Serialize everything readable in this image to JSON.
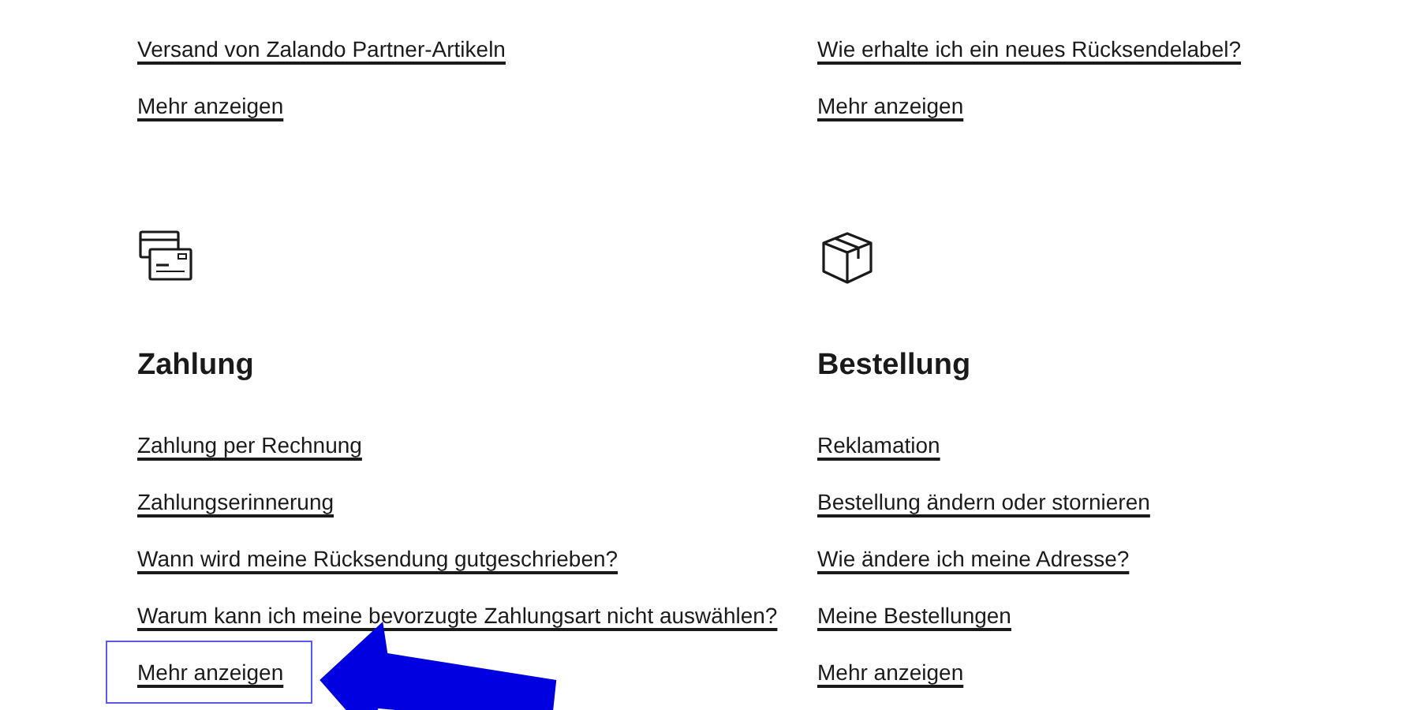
{
  "top_columns": [
    {
      "links": [
        {
          "label": "Versand von Zalando Partner-Artikeln",
          "highlighted": false
        },
        {
          "label": "Mehr anzeigen",
          "highlighted": false
        }
      ]
    },
    {
      "links": [
        {
          "label": "Wie erhalte ich ein neues Rücksendelabel?",
          "highlighted": false
        },
        {
          "label": "Mehr anzeigen",
          "highlighted": false
        }
      ]
    }
  ],
  "sections": [
    {
      "kind": "payment",
      "title": "Zahlung",
      "links": [
        {
          "label": "Zahlung per Rechnung",
          "highlighted": false
        },
        {
          "label": "Zahlungserinnerung",
          "highlighted": false
        },
        {
          "label": "Wann wird meine Rücksendung gutgeschrieben?",
          "highlighted": false
        },
        {
          "label": "Warum kann ich meine bevorzugte Zahlungsart nicht auswählen?",
          "highlighted": false
        },
        {
          "label": "Mehr anzeigen",
          "highlighted": true
        }
      ]
    },
    {
      "kind": "order",
      "title": "Bestellung",
      "links": [
        {
          "label": "Reklamation",
          "highlighted": false
        },
        {
          "label": "Bestellung ändern oder stornieren",
          "highlighted": false
        },
        {
          "label": "Wie ändere ich meine Adresse?",
          "highlighted": false
        },
        {
          "label": "Meine Bestellungen",
          "highlighted": false
        },
        {
          "label": "Mehr anzeigen",
          "highlighted": false
        }
      ]
    }
  ]
}
